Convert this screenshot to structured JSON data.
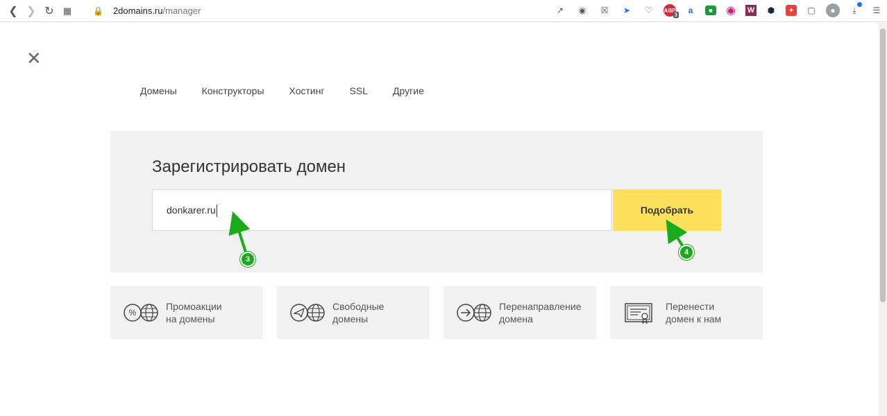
{
  "browser": {
    "url_host": "2domains.ru",
    "url_path": "/manager",
    "ext_abp_badge": "3",
    "ext_w_label": "W"
  },
  "nav": {
    "tabs": [
      "Домены",
      "Конструкторы",
      "Хостинг",
      "SSL",
      "Другие"
    ]
  },
  "register": {
    "title": "Зарегистрировать домен",
    "input_value": "donkarer.ru",
    "button_label": "Подобрать"
  },
  "cards": [
    {
      "line1": "Промоакции",
      "line2": "на домены",
      "icon": "percent-globe-icon"
    },
    {
      "line1": "Свободные",
      "line2": "домены",
      "icon": "send-globe-icon"
    },
    {
      "line1": "Перенаправление",
      "line2": "домена",
      "icon": "redirect-globe-icon"
    },
    {
      "line1": "Перенести",
      "line2": "домен к нам",
      "icon": "certificate-icon"
    }
  ],
  "annotations": {
    "marker_3": "3",
    "marker_4": "4",
    "color": "#1aab1a"
  },
  "colors": {
    "button_yellow": "#ffe05b",
    "panel_gray": "#f1f1f1"
  }
}
